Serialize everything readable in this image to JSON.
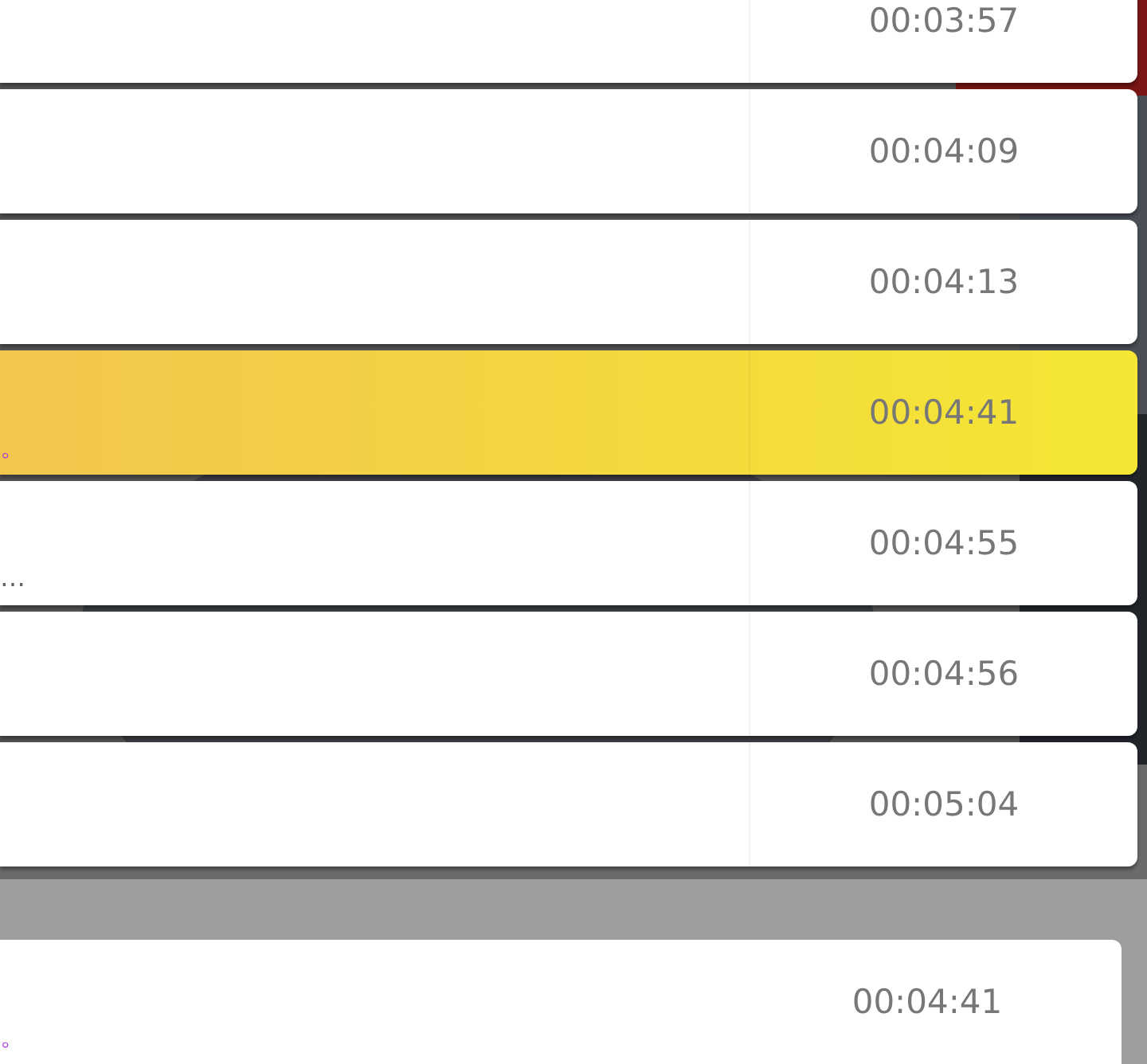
{
  "rows": [
    {
      "time": "00:03:57",
      "highlighted": false
    },
    {
      "time": "00:04:09",
      "highlighted": false
    },
    {
      "time": "00:04:13",
      "highlighted": false
    },
    {
      "time": "00:04:41",
      "highlighted": true,
      "snippet": "。"
    },
    {
      "time": "00:04:55",
      "highlighted": false,
      "snippet": "…"
    },
    {
      "time": "00:04:56",
      "highlighted": false
    },
    {
      "time": "00:05:04",
      "highlighted": false
    }
  ],
  "sheet": {
    "row": {
      "time": "00:04:41",
      "snippet": "。"
    }
  }
}
